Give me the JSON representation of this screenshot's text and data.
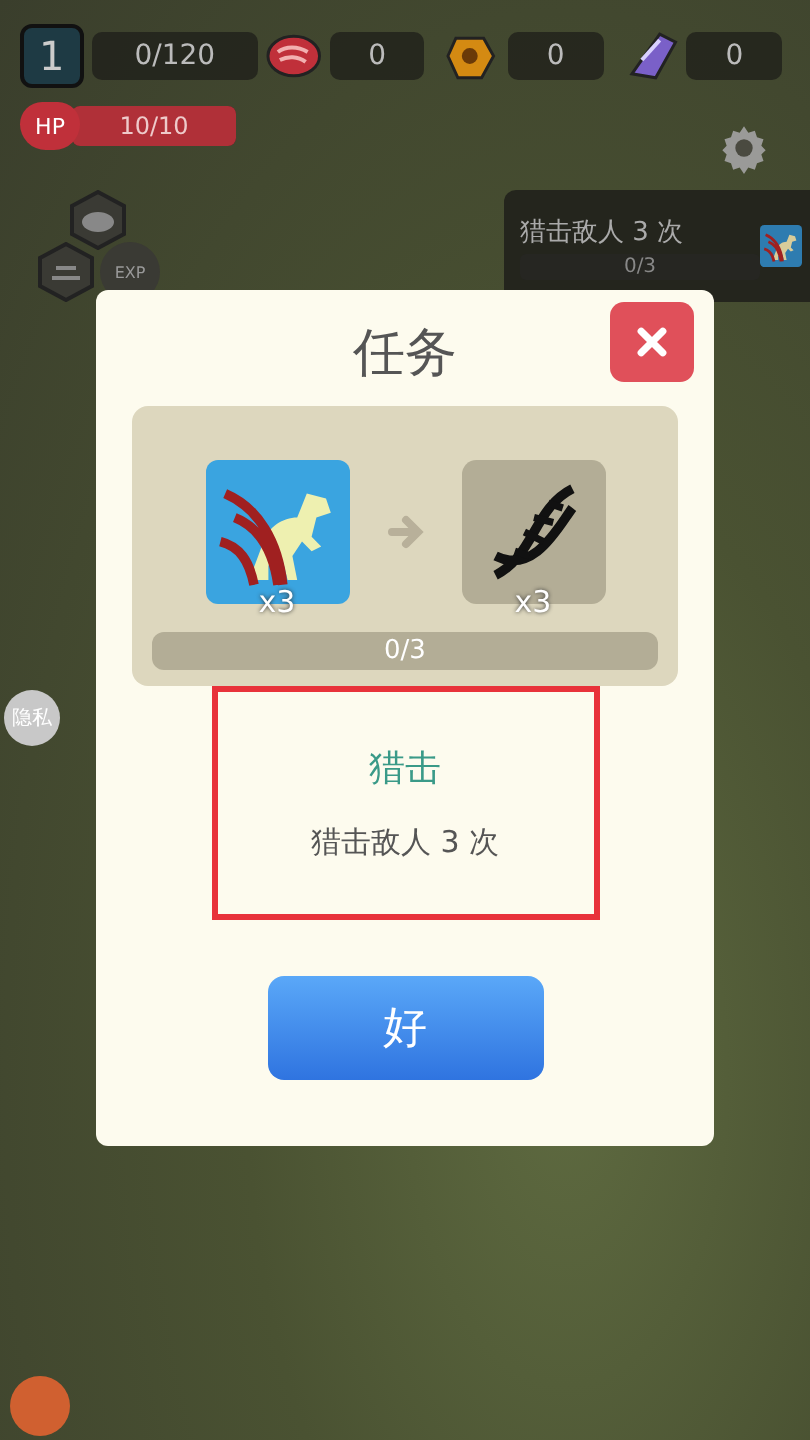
{
  "hud": {
    "player_level": "1",
    "xp": "0/120",
    "resources": [
      {
        "kind": "meat",
        "count": "0"
      },
      {
        "kind": "amber",
        "count": "0"
      },
      {
        "kind": "crystal",
        "count": "0"
      }
    ],
    "hp": {
      "label": "HP",
      "value": "10/10",
      "level": 1
    },
    "exp_badge": "EXP"
  },
  "quest_tracker": {
    "text": "猎击敌人 3 次",
    "progress": "0/3",
    "level": 0
  },
  "privacy_button": "隐私",
  "dialog": {
    "title": "任务",
    "task_count": "x3",
    "reward_count": "x3",
    "progress": {
      "label": "0/3",
      "level": 0
    },
    "task_title": "猎击",
    "task_description": "猎击敌人 3 次",
    "ok_button": "好"
  }
}
